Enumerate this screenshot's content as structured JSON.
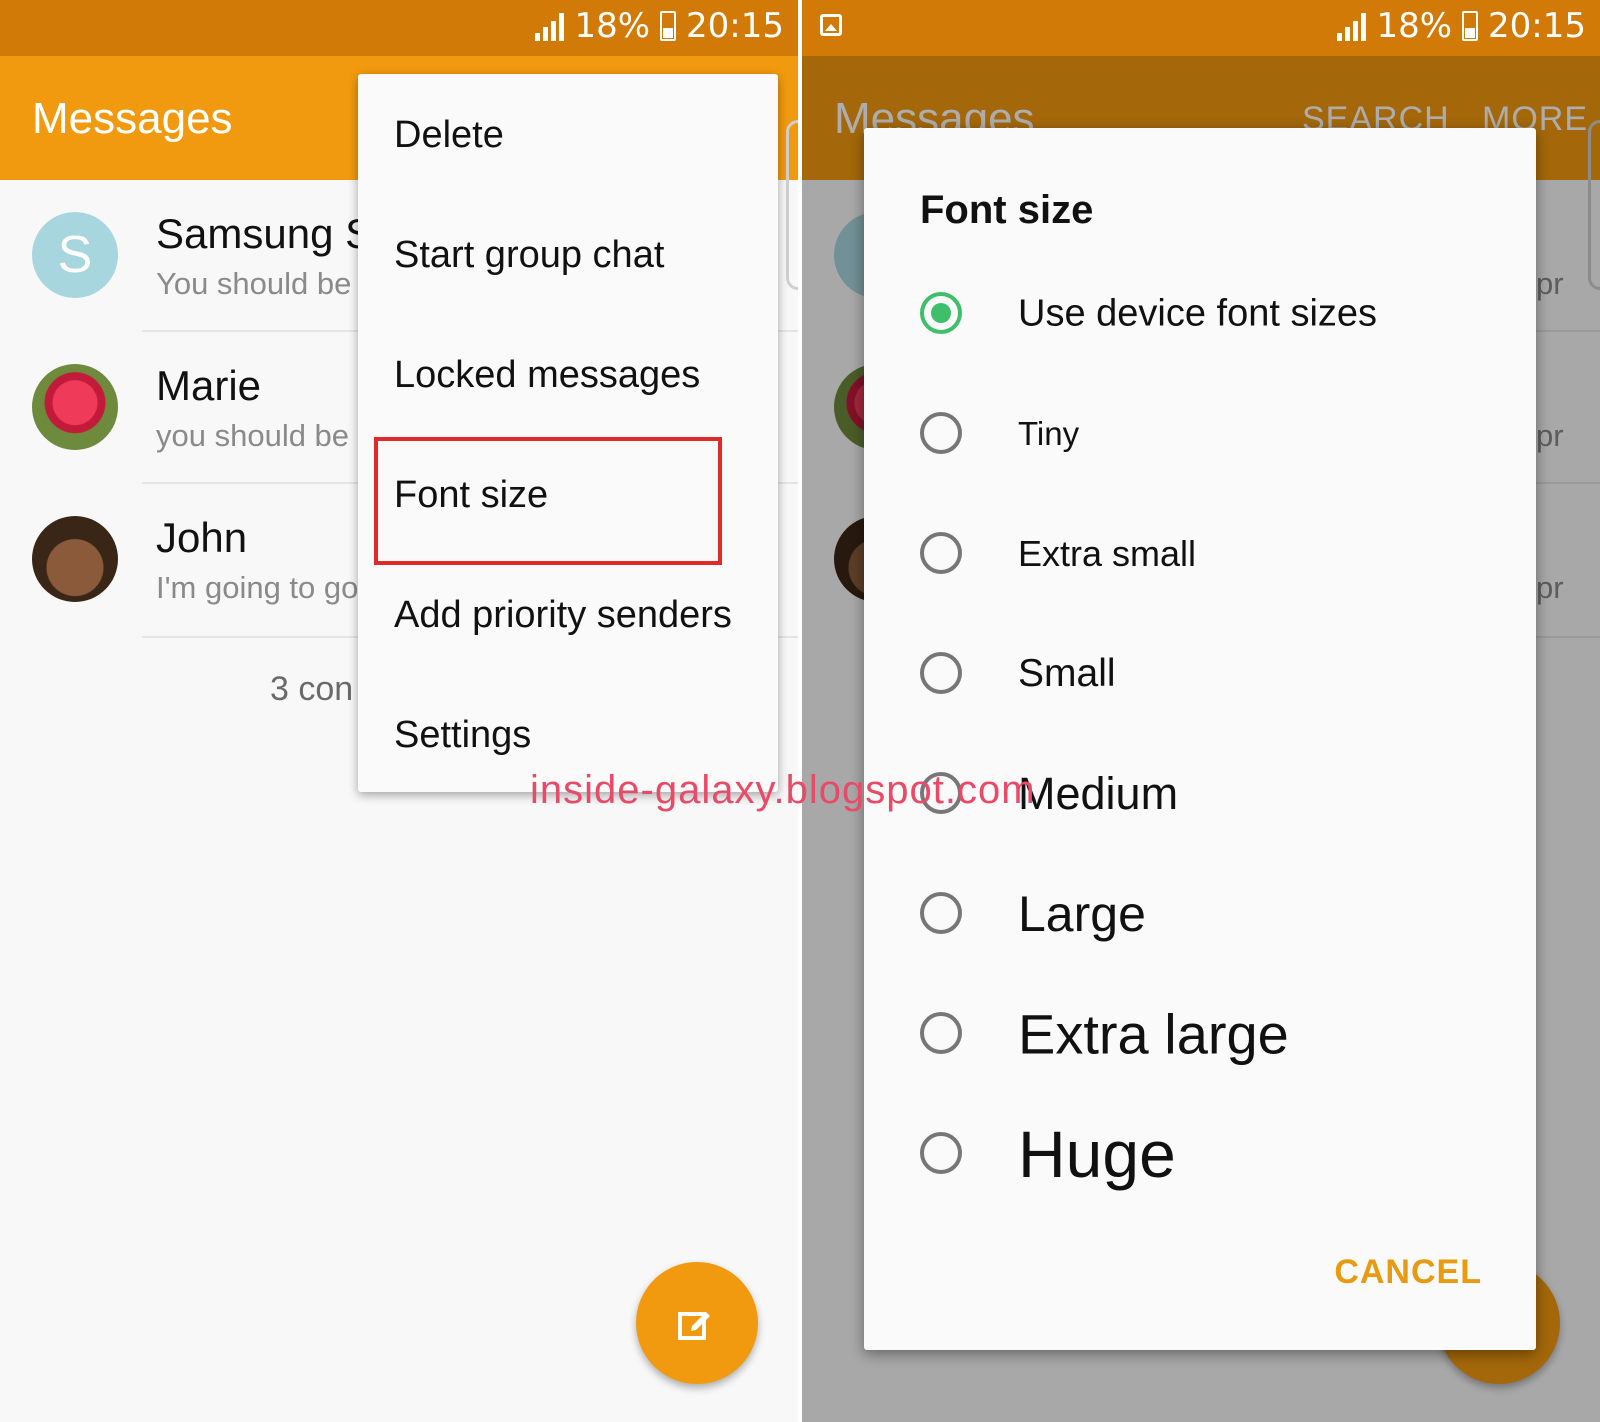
{
  "status": {
    "signal": "signal-icon",
    "battery_percent": "18%",
    "time": "20:15",
    "battery_icon": "battery-charging-icon",
    "gallery_icon": "gallery-notification-icon"
  },
  "app": {
    "title": "Messages",
    "search_label": "SEARCH",
    "more_label": "MORE"
  },
  "conversations": [
    {
      "name": "Samsung S",
      "snippet": "You should be",
      "avatar_letter": "S"
    },
    {
      "name": "Marie",
      "snippet": "you should be a",
      "avatar": "flower-photo"
    },
    {
      "name": "John",
      "snippet": "I'm going to go",
      "avatar": "face-photo"
    }
  ],
  "conversation_count": "3 con",
  "partial_right_text": [
    "pr",
    "pr",
    "pr"
  ],
  "menu": {
    "items": [
      "Delete",
      "Start group chat",
      "Locked messages",
      "Font size",
      "Add priority senders",
      "Settings"
    ],
    "highlighted_index": 3
  },
  "watermark": "inside-galaxy.blogspot.com",
  "font_dialog": {
    "title": "Font size",
    "options": [
      "Use device font sizes",
      "Tiny",
      "Extra small",
      "Small",
      "Medium",
      "Large",
      "Extra large",
      "Huge"
    ],
    "selected_index": 0,
    "cancel_label": "CANCEL"
  },
  "colors": {
    "accent": "#f29a0f",
    "statusbar": "#d27a08",
    "radio_selected": "#3fbf6a",
    "highlight_box": "#e02a2a",
    "cancel": "#e89a10"
  }
}
